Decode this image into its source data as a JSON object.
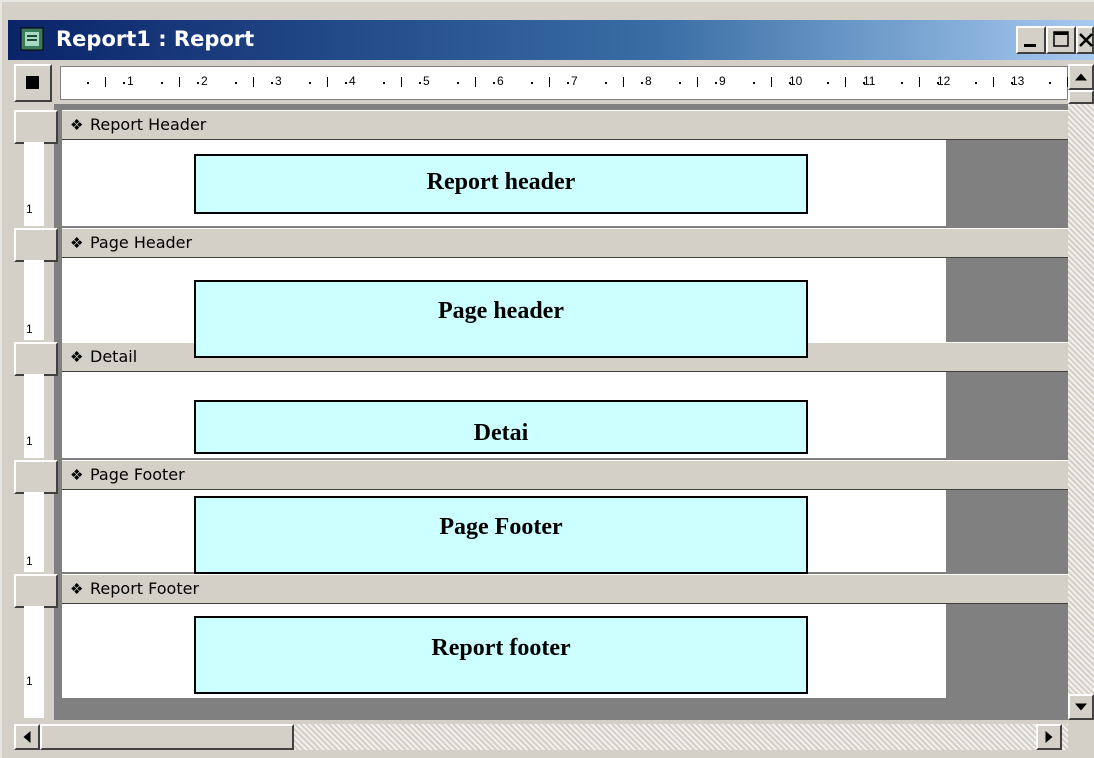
{
  "window": {
    "title": "Report1 : Report",
    "buttons": [
      "minimize",
      "maximize",
      "close"
    ]
  },
  "ruler": {
    "numbers": [
      "1",
      "2",
      "3",
      "4",
      "5",
      "6",
      "7",
      "8",
      "9",
      "10",
      "11",
      "12",
      "13"
    ]
  },
  "sections": [
    {
      "band_label": "Report Header",
      "box_text": "Report header"
    },
    {
      "band_label": "Page Header",
      "box_text": "Page header"
    },
    {
      "band_label": "Detail",
      "box_text": "Detai"
    },
    {
      "band_label": "Page Footer",
      "box_text": "Page Footer"
    },
    {
      "band_label": "Report Footer",
      "box_text": "Report footer"
    }
  ],
  "vertical_ruler_mark": "1",
  "colors": {
    "label_fill": "#ccffff",
    "title_bar_start": "#0a246a",
    "canvas_gray": "#808080"
  },
  "icons": {
    "band": "band-collapse-icon",
    "window": "report-window-icon"
  }
}
